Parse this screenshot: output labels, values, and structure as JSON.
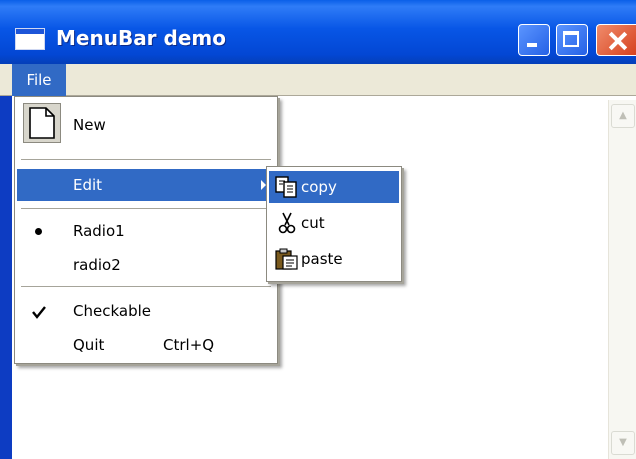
{
  "window": {
    "title": "MenuBar demo",
    "title_bar_color": "#0a55e2",
    "close_button_color": "#e2582f"
  },
  "menubar": {
    "items": [
      {
        "label": "File",
        "open": true
      }
    ],
    "highlight_color": "#316ac5"
  },
  "file_menu": {
    "new_label": "New",
    "edit_label": "Edit",
    "radio1_label": "Radio1",
    "radio2_label": "radio2",
    "checkable_label": "Checkable",
    "quit_label": "Quit",
    "quit_shortcut": "Ctrl+Q",
    "radio1_selected": true,
    "checkable_checked": true
  },
  "edit_submenu": {
    "copy_label": "copy",
    "cut_label": "cut",
    "paste_label": "paste"
  },
  "icons": {
    "new": "new-document-icon",
    "copy": "copy-icon",
    "cut": "scissors-icon",
    "paste": "clipboard-paste-icon",
    "submenu_arrow": "chevron-right-icon",
    "radio": "radio-dot-icon",
    "check": "checkmark-icon"
  }
}
